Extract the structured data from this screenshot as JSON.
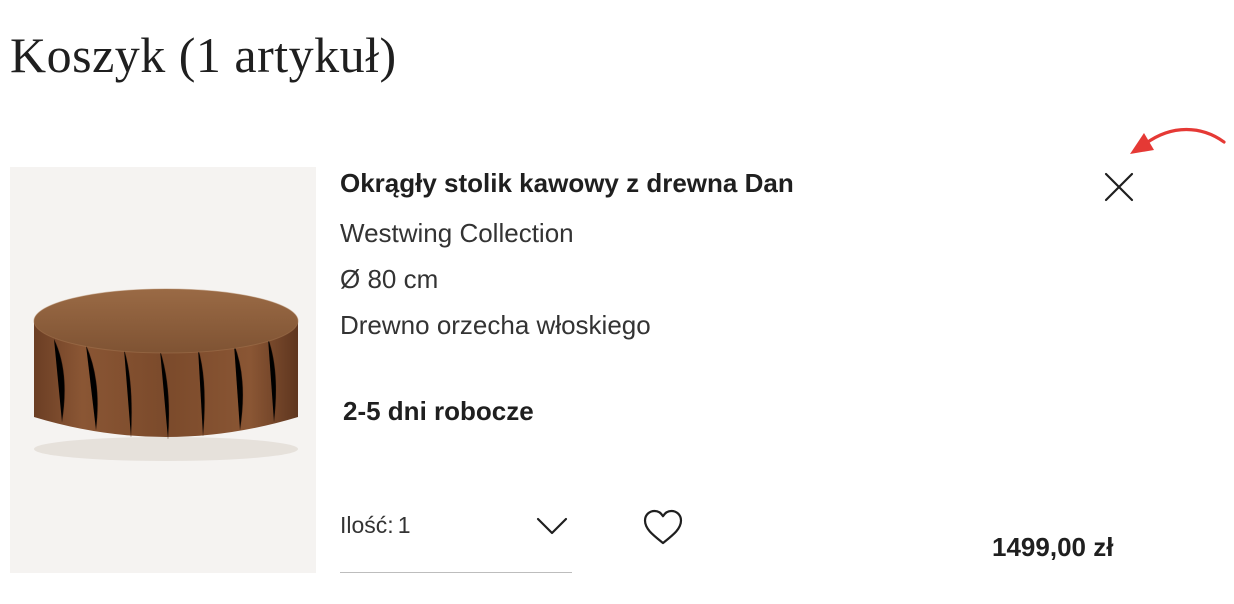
{
  "cart": {
    "title": "Koszyk (1 artykuł)"
  },
  "item": {
    "name": "Okrągły stolik kawowy z drewna Dan",
    "brand": "Westwing Collection",
    "size": "Ø 80 cm",
    "material": "Drewno orzecha włoskiego",
    "delivery": "2-5 dni robocze",
    "quantity_label": "Ilość:",
    "quantity_value": "1",
    "price": "1499,00 zł",
    "image_alt": "coffee table product image"
  },
  "icons": {
    "remove": "close-icon",
    "wishlist": "heart-icon",
    "quantity_dropdown": "chevron-down-icon"
  },
  "colors": {
    "text": "#1f1f1f",
    "annotation_arrow": "#e53935",
    "image_background": "#f5f3f1",
    "wood": "#7a4a2c"
  }
}
